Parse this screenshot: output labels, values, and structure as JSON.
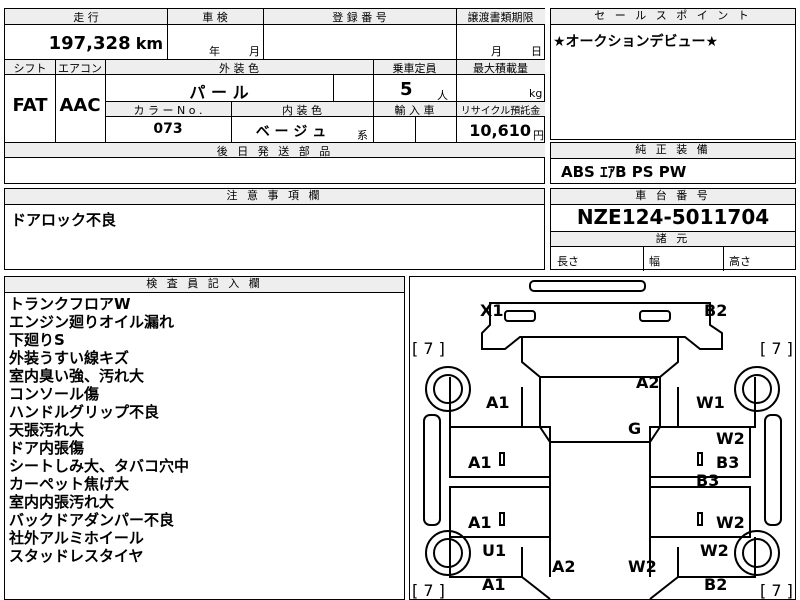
{
  "top": {
    "mileage_label": "走 行",
    "mileage_value": "197,328",
    "mileage_unit": "km",
    "inspection_label": "車 検",
    "inspection_year": "年",
    "inspection_month": "月",
    "plate_label": "登 録 番 号",
    "transfer_label": "譲渡書類期限",
    "transfer_month": "月",
    "transfer_day": "日",
    "shift_label": "シフト",
    "shift_value": "FAT",
    "ac_label": "エアコン",
    "ac_value": "AAC",
    "exterior_label": "外 装 色",
    "exterior_value": "パ ー ル",
    "capacity_label": "乗車定員",
    "capacity_value": "5",
    "capacity_unit": "人",
    "load_label": "最大積載量",
    "load_unit": "kg",
    "color_no_label": "カ ラ ー N o .",
    "color_no_value": "073",
    "interior_label": "内 装 色",
    "interior_value": "ベ ー ジ ュ",
    "interior_suffix": "系",
    "import_label": "輸 入 車",
    "recycle_label": "リサイクル預託金",
    "recycle_value": "10,610",
    "recycle_unit": "円",
    "later_label": "後 日 発 送 部 品"
  },
  "sales": {
    "label": "セ ー ル ス ポ イ ン ト",
    "text": "★オークションデビュー★"
  },
  "equipment": {
    "label": "純 正 装 備",
    "text": "ABS ｴｱB PS PW"
  },
  "notes": {
    "label": "注 意 事 項 欄",
    "text": "ドアロック不良"
  },
  "chassis": {
    "label": "車 台 番 号",
    "value": "NZE124-5011704",
    "dims_label": "諸 元",
    "length": "長さ",
    "width": "幅",
    "height": "高さ"
  },
  "inspector": {
    "label": "検 査 員 記 入 欄",
    "lines": [
      "トランクフロアW",
      "エンジン廻りオイル漏れ",
      "下廻りS",
      "外装うすい線キズ",
      "室内臭い強、汚れ大",
      "コンソール傷",
      "ハンドルグリップ不良",
      "天張汚れ大",
      "ドア内張傷",
      "シートしみ大、タバコ穴中",
      "カーペット焦げ大",
      "室内内張汚れ大",
      "バックドアダンパー不良",
      "社外アルミホイール",
      "スタッドレスタイヤ"
    ]
  },
  "diagram": {
    "marks": {
      "x1": "X1",
      "b2_top": "B2",
      "a2_roof": "A2",
      "a1_left": "A1",
      "w1": "W1",
      "g": "G",
      "w2_right_top": "W2",
      "a1_front_door": "A1",
      "b3_a": "B3",
      "b3_b": "B3",
      "a1_rear_door": "A1",
      "w2_right_mid": "W2",
      "u1": "U1",
      "w2_right_low": "W2",
      "a2_bottom": "A2",
      "w2_bottom": "W2",
      "a1_bottom": "A1",
      "b2_bottom": "B2"
    },
    "tyres": {
      "fl": "[ 7 ]",
      "fr": "[ 7 ]",
      "rl": "[ 7 ]",
      "rr": "[ 7 ]"
    }
  }
}
